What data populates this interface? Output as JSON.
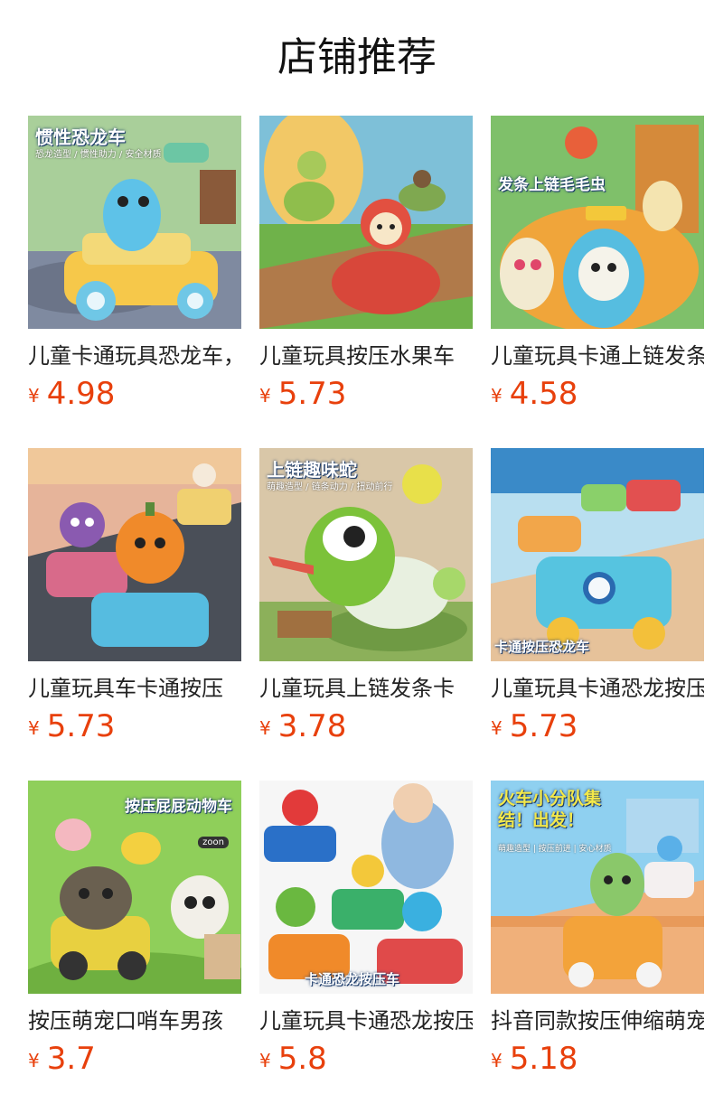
{
  "header": {
    "title": "店铺推荐"
  },
  "currency_symbol": "¥",
  "products": [
    {
      "name": "儿童卡通玩具恐龙车，",
      "price": "4.98",
      "thumb_title": "惯性恐龙车",
      "thumb_sub": "恐龙造型 / 惯性助力 / 安全材质"
    },
    {
      "name": "儿童玩具按压水果车",
      "price": "5.73",
      "thumb_title": "",
      "thumb_sub": ""
    },
    {
      "name": "儿童玩具卡通上链发条",
      "price": "4.58",
      "thumb_title": "发条上链毛毛虫",
      "thumb_sub": ""
    },
    {
      "name": "儿童玩具车卡通按压",
      "price": "5.73",
      "thumb_title": "",
      "thumb_sub": ""
    },
    {
      "name": "儿童玩具上链发条卡",
      "price": "3.78",
      "thumb_title": "上链趣味蛇",
      "thumb_sub": "萌趣造型 / 链条动力 / 扭动前行"
    },
    {
      "name": "儿童玩具卡通恐龙按压",
      "price": "5.73",
      "thumb_title": "卡通按压恐龙车",
      "thumb_sub": ""
    },
    {
      "name": "按压萌宠口哨车男孩",
      "price": "3.7",
      "thumb_title": "按压屁屁动物车",
      "thumb_sub": "zoon"
    },
    {
      "name": "儿童玩具卡通恐龙按压",
      "price": "5.8",
      "thumb_title": "卡通恐龙按压车",
      "thumb_sub": ""
    },
    {
      "name": "抖音同款按压伸缩萌宠",
      "price": "5.18",
      "thumb_title": "火车小分队集结！出发！",
      "thumb_sub": "萌趣造型 | 按压前进 | 安心材质"
    }
  ],
  "colors": {
    "price": "#e8400c",
    "title_text": "#111111",
    "name_text": "#222222"
  }
}
